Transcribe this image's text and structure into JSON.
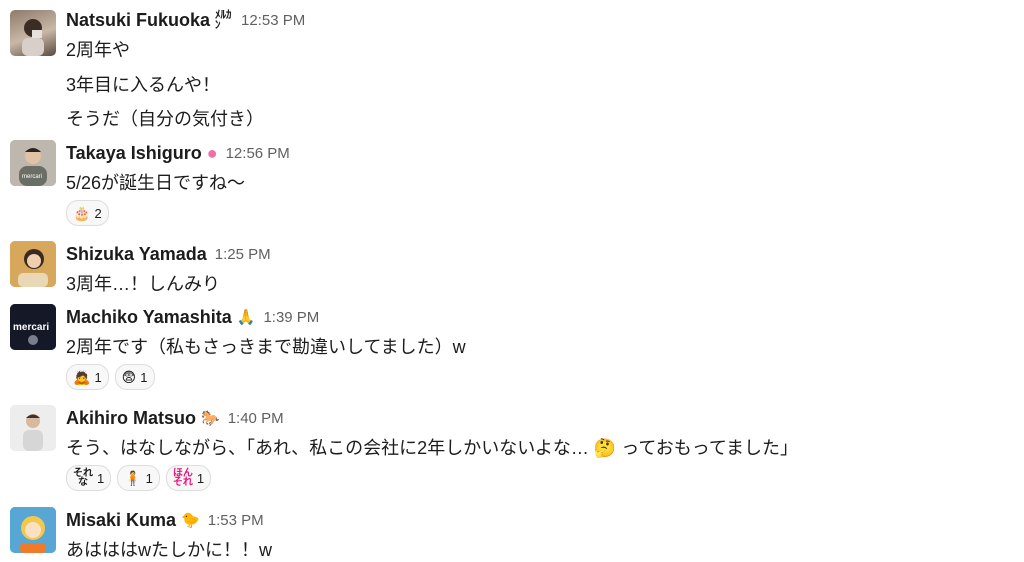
{
  "messages": [
    {
      "name": "Natsuki Fukuoka",
      "status": "ﾒﾙｶﾝ",
      "time": "12:53 PM",
      "lines": [
        "2周年や",
        "3年目に入るんや！",
        "そうだ（自分の気付き）"
      ]
    },
    {
      "name": "Takaya Ishiguro",
      "status": "●",
      "time": "12:56 PM",
      "lines": [
        "5/26が誕生日ですね〜"
      ],
      "reactions": [
        {
          "emoji": "🎂",
          "count": "2"
        }
      ]
    },
    {
      "name": "Shizuka Yamada",
      "time": "1:25 PM",
      "lines": [
        "3周年…！しんみり"
      ]
    },
    {
      "name": "Machiko Yamashita",
      "status": "🙏",
      "time": "1:39 PM",
      "lines": [
        "2周年です（私もさっきまで勘違いしてました）w"
      ],
      "reactions": [
        {
          "emoji": "🙇",
          "count": "1"
        },
        {
          "emoji": "😨",
          "count": "1"
        }
      ]
    },
    {
      "name": "Akihiro Matsuo",
      "status": "🐎",
      "time": "1:40 PM",
      "lines": [
        "そう、はなしながら、「あれ、私この会社に2年しかいないよな… 🤔 っておもってました」"
      ],
      "reactions": [
        {
          "emoji": "それな",
          "count": "1"
        },
        {
          "emoji": "🧍",
          "count": "1"
        },
        {
          "emoji": "ほんそれ",
          "count": "1"
        }
      ]
    },
    {
      "name": "Misaki Kuma",
      "status": "🐤",
      "time": "1:53 PM",
      "lines": [
        "あはははwたしかに！！w"
      ]
    }
  ]
}
